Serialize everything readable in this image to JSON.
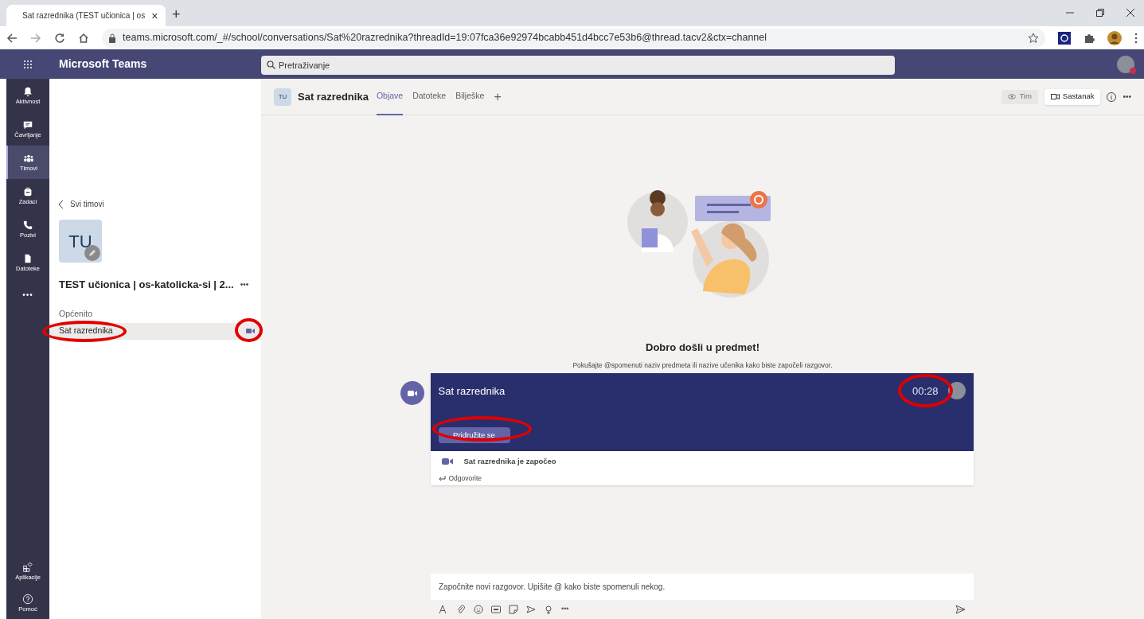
{
  "browser": {
    "tab_title": "Sat razrednika (TEST učionica | os",
    "tab_close": "×",
    "new_tab": "+",
    "url": "teams.microsoft.com/_#/school/conversations/Sat%20razrednika?threadId=19:07fca36e92974bcabb451d4bcc7e53b6@thread.tacv2&ctx=channel"
  },
  "header": {
    "app_name": "Microsoft Teams",
    "search": {
      "placeholder": "Pretraživanje"
    }
  },
  "rail": [
    {
      "label": "Aktivnost",
      "selected": false
    },
    {
      "label": "Čavrljanje",
      "selected": false
    },
    {
      "label": "Timovi",
      "selected": true
    },
    {
      "label": "Zadaci",
      "selected": false
    },
    {
      "label": "Pozivi",
      "selected": false
    },
    {
      "label": "Datoteke",
      "selected": false
    }
  ],
  "rail_more": "•••",
  "rail_bottom": [
    {
      "label": "Aplikacije"
    },
    {
      "label": "Pomoć"
    }
  ],
  "sidebar": {
    "back": "Svi timovi",
    "team_initials": "TU",
    "team_name": "TEST učionica | os-katolicka-si | 2...",
    "team_more": "•••",
    "channels": [
      {
        "name": "Općenito",
        "selected": false,
        "meeting_active": false
      },
      {
        "name": "Sat razrednika",
        "selected": true,
        "meeting_active": true
      }
    ]
  },
  "channel_header": {
    "initials": "TU",
    "name": "Sat razrednika",
    "tabs": [
      {
        "label": "Objave",
        "selected": true
      },
      {
        "label": "Datoteke",
        "selected": false
      },
      {
        "label": "Bilješke",
        "selected": false
      }
    ],
    "add_tab": "+",
    "team_button": "Tim",
    "meeting_button": "Sastanak",
    "more": "•••"
  },
  "welcome": {
    "title": "Dobro došli u predmet!",
    "subtitle": "Pokušajte @spomenuti naziv predmeta ili nazive učenika kako biste započeli razgovor."
  },
  "meeting_card": {
    "title": "Sat razrednika",
    "timer": "00:28",
    "join_button": "Pridružite se",
    "status": "Sat razrednika je započeo",
    "reply": "Odgovorite"
  },
  "compose": {
    "placeholder": "Započnite novi razgovor. Upišite @ kako biste spomenuli nekog.",
    "more": "•••"
  }
}
